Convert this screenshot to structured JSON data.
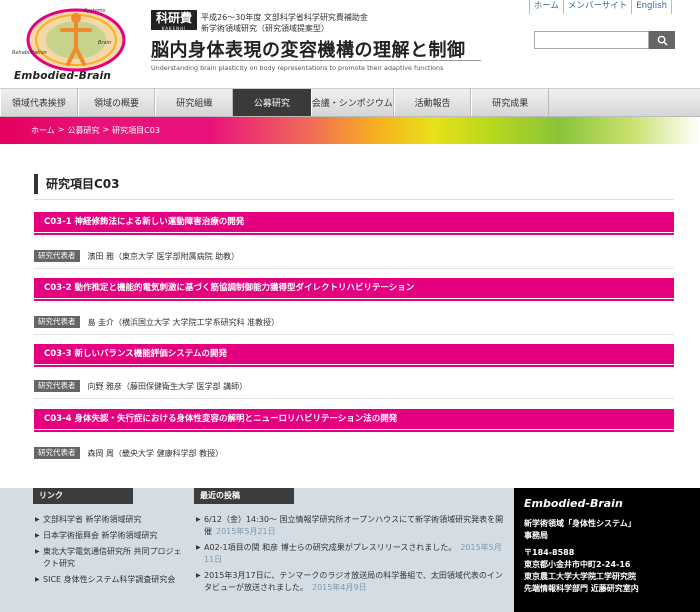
{
  "header": {
    "logo_text": "Embodied-Brain",
    "logo_labels": [
      "Systems engineering",
      "Brain science",
      "Rehabilitation medicine"
    ],
    "kakenhi": "科研費",
    "kakenhi_sub": "KAKENHI",
    "period": "平成26～30年度 文部科学省科学研究費補助金",
    "category": "新学術領域研究（研究領域提案型）",
    "title": "脳内身体表現の変容機構の理解と制御",
    "subtitle": "Understanding brain plasticity on body representations to promote their adaptive functions",
    "top_links": [
      "ホーム",
      "メンバーサイト",
      "English"
    ],
    "search_placeholder": ""
  },
  "nav": {
    "items": [
      "領域代表挨拶",
      "領域の概要",
      "研究組織",
      "公募研究",
      "会議・シンポジウム",
      "活動報告",
      "研究成果"
    ],
    "active_index": 3
  },
  "breadcrumb": {
    "items": [
      "ホーム",
      "公募研究",
      "研究項目C03"
    ],
    "separator": ">"
  },
  "content": {
    "page_title": "研究項目C03",
    "rep_label": "研究代表者",
    "items": [
      {
        "title": "C03-1 神経修飾法による新しい運動障害治療の開発",
        "representative": "濱田 雅（東京大学 医学部附属病院 助教）"
      },
      {
        "title": "C03-2 動作推定と機能的電気刺激に基づく筋協調制御能力獲得型ダイレクトリハビリテーション",
        "representative": "島 圭介（横浜国立大学 大学院工学系研究科 准教授）"
      },
      {
        "title": "C03-3 新しいバランス機能評価システムの開発",
        "representative": "向野 雅彦（藤田保健衛生大学 医学部 講師）"
      },
      {
        "title": "C03-4 身体失認・失行症における身体性変容の解明とニューロリハビリテーション法の開発",
        "representative": "森岡 周（畿央大学 健康科学部 教授）"
      }
    ]
  },
  "footer": {
    "links_heading": "リンク",
    "links": [
      "文部科学省 新学術領域研究",
      "日本学術振興会 新学術領域研究",
      "東北大学電気通信研究所 共同プロジェクト研究",
      "SICE 身体性システム科学調査研究会"
    ],
    "news_heading": "最近の投稿",
    "news": [
      {
        "text": "6/12（金）14:30～ 国立情報学研究所オープンハウスにて新学術領域研究発表を開催",
        "date": "2015年5月21日"
      },
      {
        "text": "A02-1項目の関 和彦 博士らの研究成果がプレスリリースされました。",
        "date": "2015年5月11日"
      },
      {
        "text": "2015年3月17日に、テンマークのラジオ放送局の科学番組で、太田領域代表のインタビューが放送されました。",
        "date": "2015年4月9日"
      }
    ],
    "contact": {
      "brand": "Embodied-Brain",
      "lines": [
        "新学術領域「身体性システム」",
        "事務局",
        "〒184-8588",
        "東京都小金井市中町2-24-16",
        "東京農工大学大学院工学研究院",
        "先端情報科学部門 近藤研究室内"
      ]
    }
  },
  "colors": {
    "magenta": "#e4007f",
    "nav_active": "#3a3a3a",
    "footer_bg": "#d5dde4",
    "link_blue": "#3a6a9a"
  }
}
